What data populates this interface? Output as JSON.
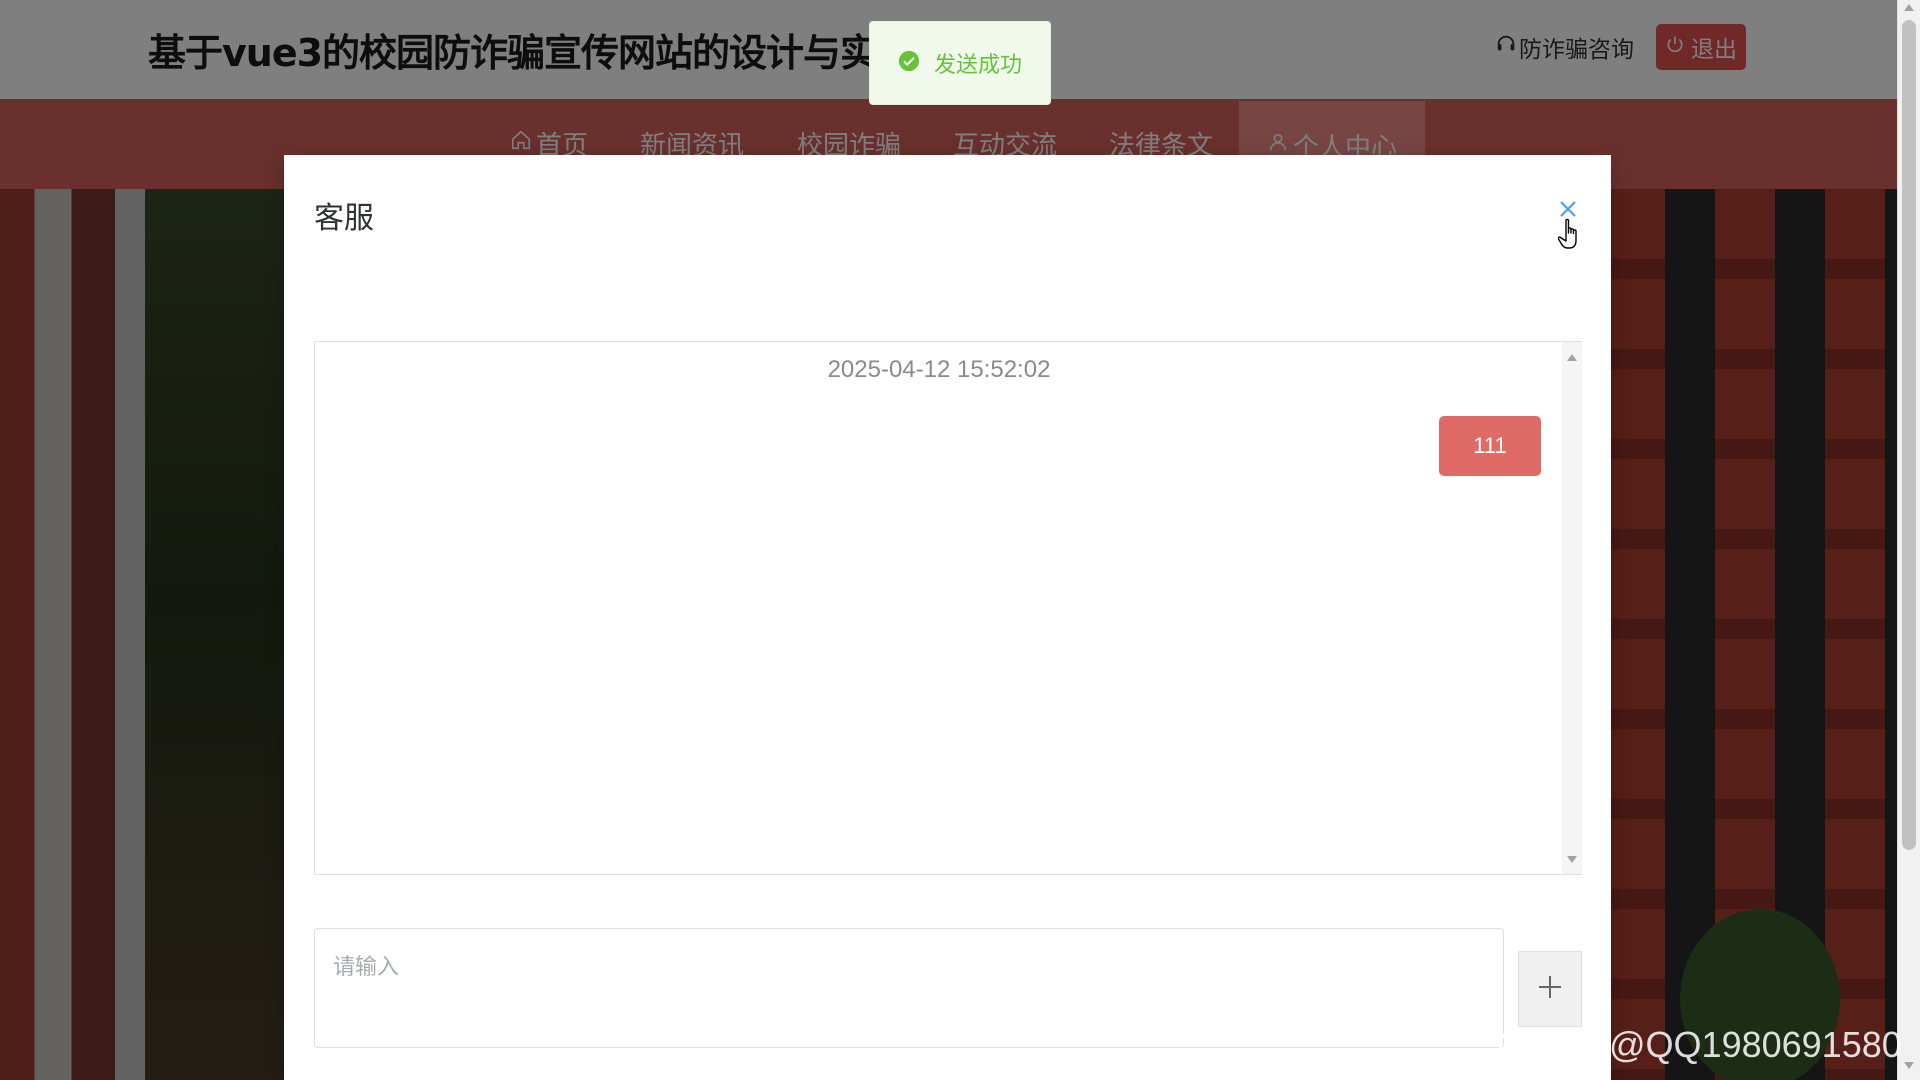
{
  "header": {
    "site_title": "基于vue3的校园防诈骗宣传网站的设计与实现",
    "consult_label": "防诈骗咨询",
    "logout_label": "退出"
  },
  "nav": {
    "items": [
      {
        "label": "首页",
        "icon": "home-icon"
      },
      {
        "label": "新闻资讯"
      },
      {
        "label": "校园诈骗"
      },
      {
        "label": "互动交流"
      },
      {
        "label": "法律条文"
      },
      {
        "label": "个人中心",
        "icon": "user-icon",
        "active": true
      }
    ]
  },
  "dialog": {
    "title": "客服",
    "chat": {
      "messages": [
        {
          "time": "2025-04-12 15:52:02",
          "text": "111",
          "side": "right"
        }
      ]
    },
    "input": {
      "placeholder": "请输入",
      "value": ""
    },
    "send_icon": "plus-icon"
  },
  "toast": {
    "text": "发送成功",
    "icon": "check-circle-icon",
    "type": "success"
  },
  "watermark": "CSDN @QQ1980691580",
  "colors": {
    "brand": "#e0534f",
    "nav_bg": "#d5605a",
    "bubble": "#e06b66",
    "success": "#67c23a"
  }
}
